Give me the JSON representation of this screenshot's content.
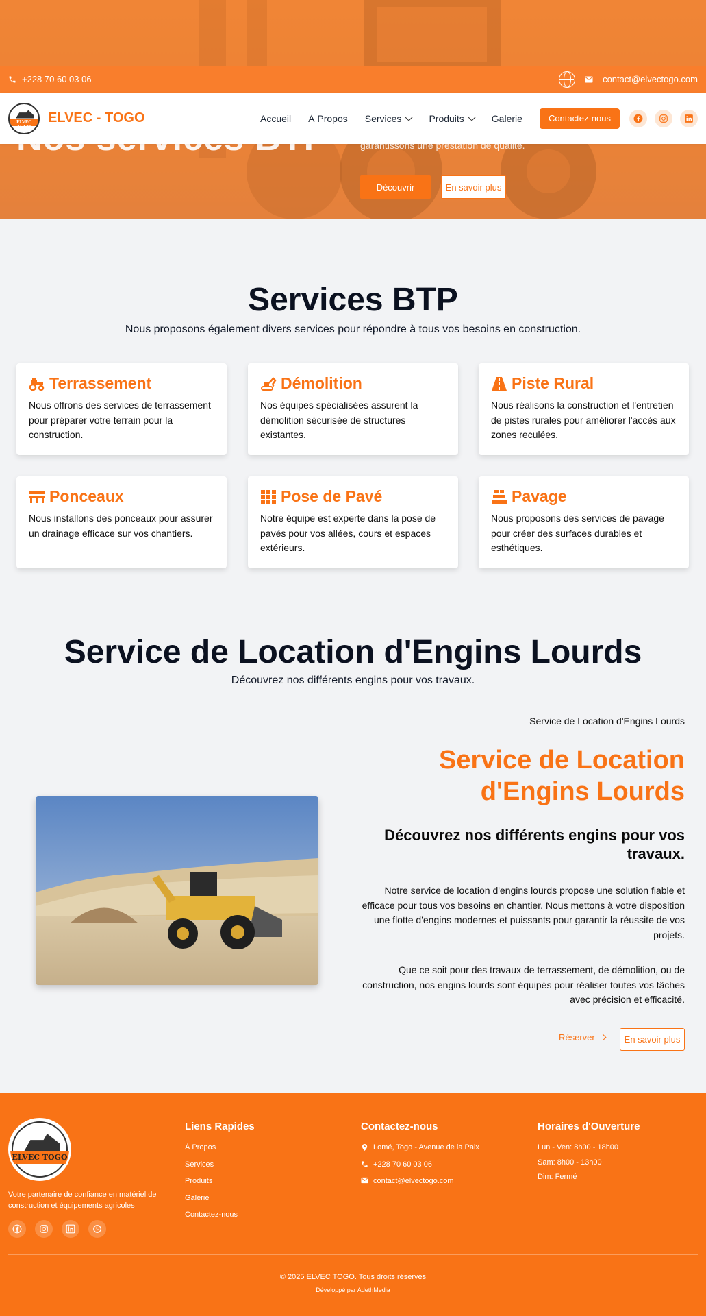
{
  "hero": {
    "title": "Nos services BTP",
    "subtitle": "garantissons une prestation de qualité.",
    "discover_label": "Découvrir",
    "learn_more_label": "En savoir plus"
  },
  "topbar": {
    "phone": "+228 70 60 03 06",
    "email": "contact@elvectogo.com"
  },
  "navbar": {
    "brand": "ELVEC - TOGO",
    "logo_text": "ELVEC TOGO",
    "links": [
      "Accueil",
      "À Propos",
      "Services",
      "Produits",
      "Galerie"
    ],
    "contact_label": "Contactez-nous"
  },
  "services": {
    "title": "Services BTP",
    "subtitle": "Nous proposons également divers services pour répondre à tous vos besoins en construction.",
    "cards": [
      {
        "title": "Terrassement",
        "text": "Nous offrons des services de terrassement pour préparer votre terrain pour la construction.",
        "icon": "tractor-icon"
      },
      {
        "title": "Démolition",
        "text": "Nos équipes spécialisées assurent la démolition sécurisée de structures existantes.",
        "icon": "excavator-icon"
      },
      {
        "title": "Piste Rural",
        "text": "Nous réalisons la construction et l'entretien de pistes rurales pour améliorer l'accès aux zones reculées.",
        "icon": "road-icon"
      },
      {
        "title": "Ponceaux",
        "text": "Nous installons des ponceaux pour assurer un drainage efficace sur vos chantiers.",
        "icon": "bridge-icon"
      },
      {
        "title": "Pose de Pavé",
        "text": "Notre équipe est experte dans la pose de pavés pour vos allées, cours et espaces extérieurs.",
        "icon": "grid-icon"
      },
      {
        "title": "Pavage",
        "text": "Nous proposons des services de pavage pour créer des surfaces durables et esthétiques.",
        "icon": "paving-icon"
      }
    ]
  },
  "location": {
    "title": "Service de Location d'Engins Lourds",
    "subtitle": "Découvrez nos différents engins pour vos travaux.",
    "small_label": "Service de Location d'Engins Lourds",
    "big_title": "Service de Location d'Engins Lourds",
    "heading": "Découvrez nos différents engins pour vos travaux.",
    "para1": "Notre service de location d'engins lourds propose une solution fiable et efficace pour tous vos besoins en chantier. Nous mettons à votre disposition une flotte d'engins modernes et puissants pour garantir la réussite de vos projets.",
    "para2": "Que ce soit pour des travaux de terrassement, de démolition, ou de construction, nos engins lourds sont équipés pour réaliser toutes vos tâches avec précision et efficacité.",
    "reserve_label": "Réserver",
    "learn_more_label": "En savoir plus"
  },
  "footer": {
    "logo_text": "ELVEC TOGO",
    "tagline": "Votre partenaire de confiance en matériel de construction et équipements agricoles",
    "quick_links_title": "Liens Rapides",
    "quick_links": [
      "À Propos",
      "Services",
      "Produits",
      "Galerie",
      "Contactez-nous"
    ],
    "contact_title": "Contactez-nous",
    "address": "Lomé, Togo - Avenue de la Paix",
    "phone": "+228 70 60 03 06",
    "email": "contact@elvectogo.com",
    "hours_title": "Horaires d'Ouverture",
    "hours": [
      "Lun - Ven: 8h00 - 18h00",
      "Sam: 8h00 - 13h00",
      "Dim: Fermé"
    ],
    "copyright": "© 2025 ELVEC TOGO. Tous droits réservés",
    "developer": "Développé par AdethMedia"
  },
  "colors": {
    "accent": "#f97316",
    "topbar": "#f97e2c",
    "background": "#f2f3f5",
    "heading": "#0b1120"
  }
}
